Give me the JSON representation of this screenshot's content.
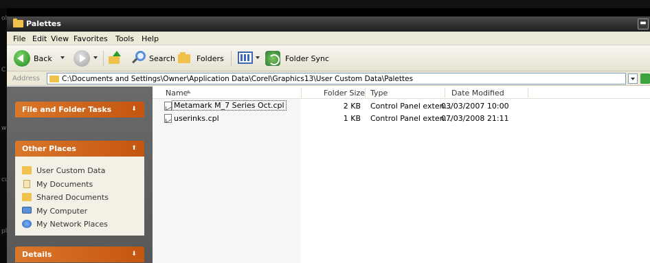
{
  "window": {
    "title": "Palettes"
  },
  "menu": [
    "File",
    "Edit",
    "View",
    "Favorites",
    "Tools",
    "Help"
  ],
  "toolbar": {
    "back_label": "Back",
    "search_label": "Search",
    "folders_label": "Folders",
    "folder_sync_label": "Folder Sync"
  },
  "address": {
    "label": "Address",
    "path": "C:\\Documents and Settings\\Owner\\Application Data\\Corel\\Graphics13\\User Custom Data\\Palettes"
  },
  "taskpane": {
    "file_folder_tasks": "File and Folder Tasks",
    "other_places": "Other Places",
    "places": [
      {
        "label": "User Custom Data",
        "icon": "folder-icon"
      },
      {
        "label": "My Documents",
        "icon": "documents-icon"
      },
      {
        "label": "Shared Documents",
        "icon": "folder-icon"
      },
      {
        "label": "My Computer",
        "icon": "computer-icon"
      },
      {
        "label": "My Network Places",
        "icon": "network-icon"
      }
    ],
    "details": "Details"
  },
  "columns": {
    "name": "Name",
    "folder_size": "Folder Size",
    "type": "Type",
    "date_modified": "Date Modified"
  },
  "files": [
    {
      "name": "Metamark M_7 Series Oct.cpl",
      "size": "2 KB",
      "type": "Control Panel exten...",
      "date": "03/03/2007 10:00"
    },
    {
      "name": "userinks.cpl",
      "size": "1 KB",
      "type": "Control Panel exten...",
      "date": "07/03/2008 21:11"
    }
  ],
  "colors": {
    "title_bar": "#2a2a2a",
    "task_header": "#d2651c",
    "task_pane_bg": "#5f5f5f",
    "toolbar_bg": "#ece9d8"
  }
}
